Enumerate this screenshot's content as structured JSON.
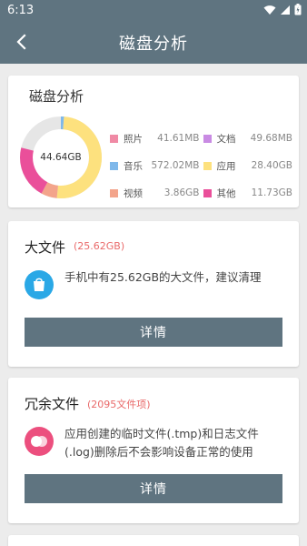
{
  "status_bar": {
    "time": "6:13"
  },
  "header": {
    "title": "磁盘分析"
  },
  "disk_card": {
    "title": "磁盘分析",
    "total": "44.64GB",
    "legend": [
      {
        "label": "照片",
        "value": "41.61MB",
        "color": "#f08aa5"
      },
      {
        "label": "文档",
        "value": "49.68MB",
        "color": "#c98be3"
      },
      {
        "label": "音乐",
        "value": "572.02MB",
        "color": "#7fb8ea"
      },
      {
        "label": "应用",
        "value": "28.40GB",
        "color": "#fde17e"
      },
      {
        "label": "视频",
        "value": "3.86GB",
        "color": "#f3a48b"
      },
      {
        "label": "其他",
        "value": "11.73GB",
        "color": "#ea4f9a"
      }
    ]
  },
  "large_files": {
    "title": "大文件",
    "size": "(25.62GB)",
    "desc": "手机中有25.62GB的大文件，建议清理",
    "button": "详情",
    "icon_color": "#2aa8e6"
  },
  "redundant_files": {
    "title": "冗余文件",
    "size": "(2095文件项)",
    "desc": "应用创建的临时文件(.tmp)和日志文件(.log)删除后不会影响设备正常的使用",
    "button": "详情",
    "icon_color": "#ec4f7e"
  }
}
